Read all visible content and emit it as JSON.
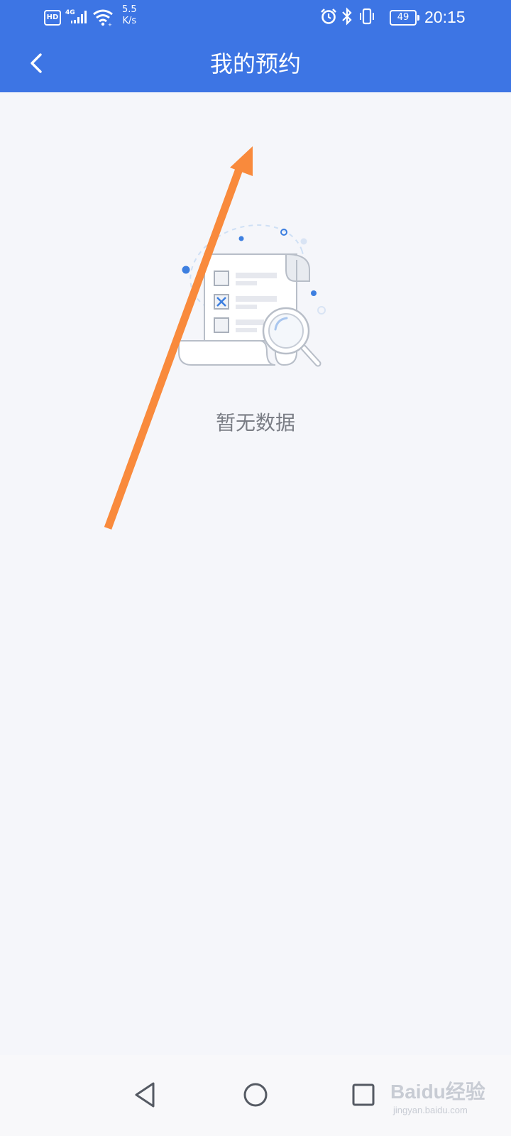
{
  "status_bar": {
    "hd": "HD",
    "network": "4G",
    "net_speed_value": "5.5",
    "net_speed_unit": "K/s",
    "battery": "49",
    "time": "20:15"
  },
  "header": {
    "title": "我的预约",
    "back_icon": "chevron-left-icon"
  },
  "empty_state": {
    "message": "暂无数据",
    "illustration": "empty-document-search"
  },
  "nav_bar": {
    "back_icon": "triangle-back-icon",
    "home_icon": "circle-home-icon",
    "recent_icon": "square-recents-icon"
  },
  "watermark": {
    "logo": "Baidu经验",
    "url": "jingyan.baidu.com"
  },
  "colors": {
    "header_bg": "#3d75e4",
    "page_bg": "#f5f6fa",
    "arrow": "#f98a3c"
  }
}
